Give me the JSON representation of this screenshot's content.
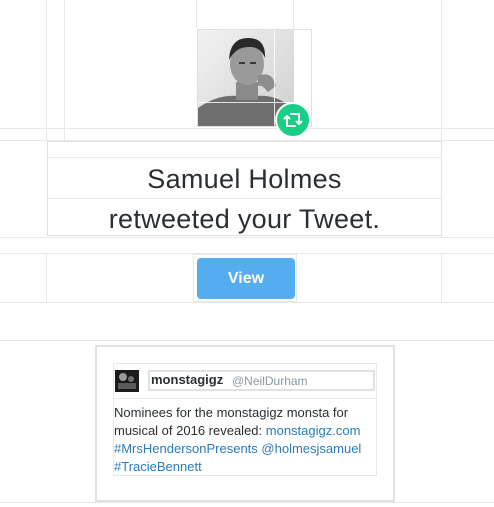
{
  "notification": {
    "line1": "Samuel Holmes",
    "line2": "retweeted your Tweet.",
    "badge_icon": "retweet-icon",
    "badge_color": "#19cf86"
  },
  "actions": {
    "view_label": "View",
    "view_color": "#55acee"
  },
  "tweet": {
    "name": "monstagigz",
    "handle": "@NeilDurham",
    "text_prefix": "Nominees for the monstagigz monsta for musical of 2016 revealed: ",
    "link1": "monstagigz.com",
    "hashtag1": "#MrsHendersonPresents",
    "mention1": "@holmesjsamuel",
    "hashtag2": "#TracieBennett",
    "link_color": "#2b7bb9"
  }
}
